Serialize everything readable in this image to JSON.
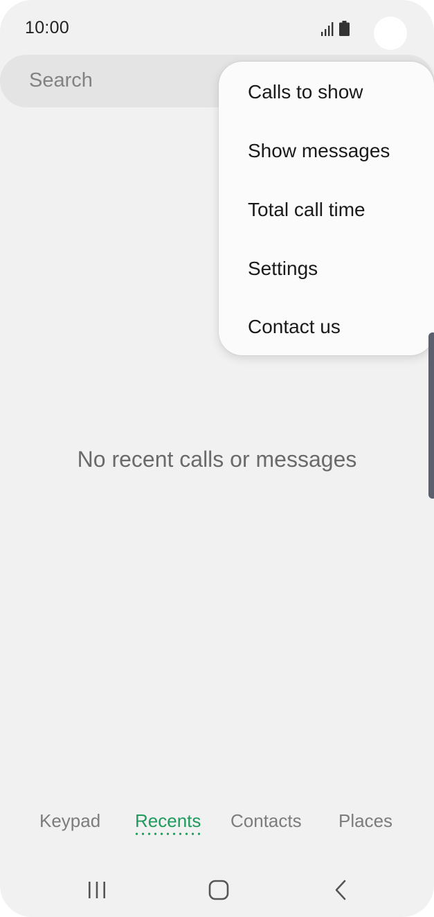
{
  "status_bar": {
    "time": "10:00",
    "signal_icon": "signal-bars-icon",
    "battery_icon": "battery-icon"
  },
  "search": {
    "placeholder": "Search"
  },
  "overflow_menu": {
    "items": [
      "Calls to show",
      "Show messages",
      "Total call time",
      "Settings",
      "Contact us"
    ]
  },
  "main": {
    "empty_message": "No recent calls or messages"
  },
  "tabs": [
    {
      "label": "Keypad",
      "active": false
    },
    {
      "label": "Recents",
      "active": true
    },
    {
      "label": "Contacts",
      "active": false
    },
    {
      "label": "Places",
      "active": false
    }
  ],
  "nav_bar": {
    "recents_icon": "recent-apps-icon",
    "home_icon": "home-icon",
    "back_icon": "back-icon"
  },
  "colors": {
    "background": "#f1f1f1",
    "accent": "#1f9a5d",
    "menu_background": "#fbfbfb"
  }
}
